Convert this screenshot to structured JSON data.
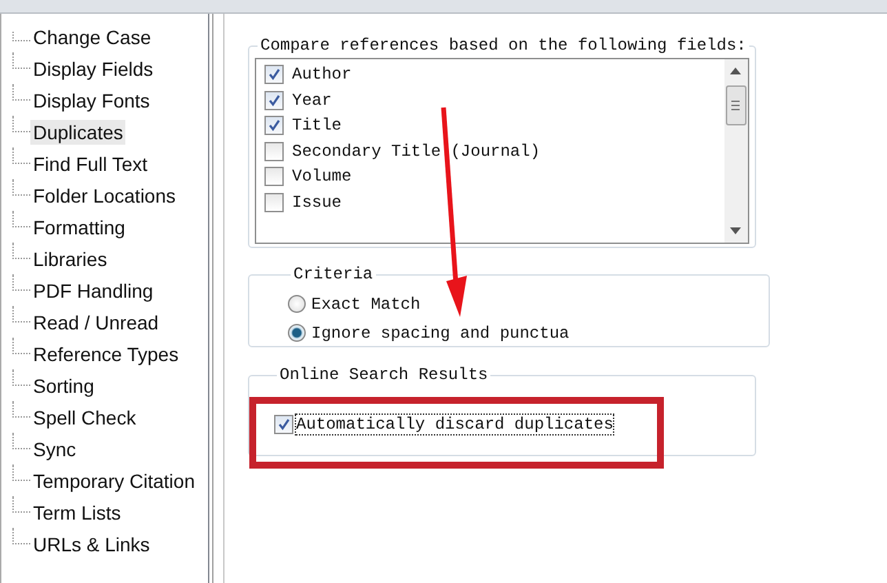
{
  "sidebar": {
    "items": [
      {
        "label": "Change Case",
        "selected": false
      },
      {
        "label": "Display Fields",
        "selected": false
      },
      {
        "label": "Display Fonts",
        "selected": false
      },
      {
        "label": "Duplicates",
        "selected": true
      },
      {
        "label": "Find Full Text",
        "selected": false
      },
      {
        "label": "Folder Locations",
        "selected": false
      },
      {
        "label": "Formatting",
        "selected": false
      },
      {
        "label": "Libraries",
        "selected": false
      },
      {
        "label": "PDF Handling",
        "selected": false
      },
      {
        "label": "Read / Unread",
        "selected": false
      },
      {
        "label": "Reference Types",
        "selected": false
      },
      {
        "label": "Sorting",
        "selected": false
      },
      {
        "label": "Spell Check",
        "selected": false
      },
      {
        "label": "Sync",
        "selected": false
      },
      {
        "label": "Temporary Citation",
        "selected": false
      },
      {
        "label": "Term Lists",
        "selected": false
      },
      {
        "label": "URLs & Links",
        "selected": false
      }
    ]
  },
  "compare_fields": {
    "legend": "Compare references based on the following fields:",
    "fields": [
      {
        "label": "Author",
        "checked": true
      },
      {
        "label": "Year",
        "checked": true
      },
      {
        "label": "Title",
        "checked": true
      },
      {
        "label": "Secondary Title (Journal)",
        "checked": false
      },
      {
        "label": "Volume",
        "checked": false
      },
      {
        "label": "Issue",
        "checked": false
      }
    ]
  },
  "criteria": {
    "legend": "Criteria",
    "options": [
      {
        "label": "Exact Match",
        "selected": false
      },
      {
        "label": "Ignore spacing and punctua",
        "selected": true
      }
    ]
  },
  "online_search_results": {
    "legend": "Online Search Results",
    "options": [
      {
        "label": "Automatically discard duplicates",
        "checked": true
      }
    ]
  }
}
